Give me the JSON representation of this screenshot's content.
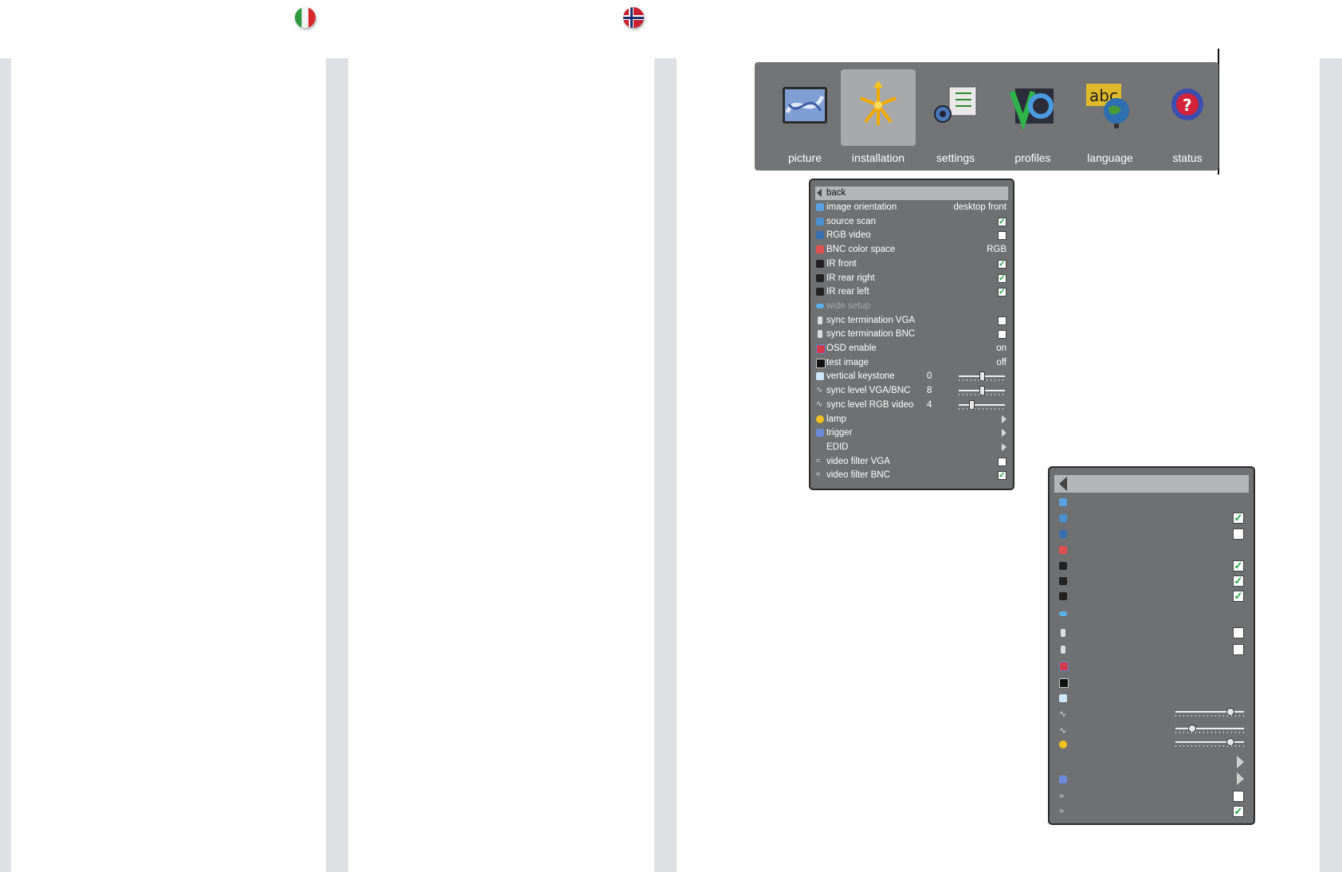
{
  "top_menu": {
    "items": [
      {
        "label": "picture",
        "icon": "picture-icon",
        "selected": false
      },
      {
        "label": "installation",
        "icon": "installation-icon",
        "selected": true
      },
      {
        "label": "settings",
        "icon": "settings-icon",
        "selected": false
      },
      {
        "label": "profiles",
        "icon": "profiles-icon",
        "selected": false
      },
      {
        "label": "language",
        "icon": "language-icon",
        "selected": false
      },
      {
        "label": "status",
        "icon": "status-icon",
        "selected": false
      }
    ]
  },
  "flags": [
    "italy-flag-icon",
    "norway-flag-icon"
  ],
  "installation_menu": {
    "back_label": "back",
    "rows": [
      {
        "label": "image orientation",
        "value": "desktop front"
      },
      {
        "label": "source scan",
        "checked": true
      },
      {
        "label": "RGB video",
        "checked": false
      },
      {
        "label": "BNC color space",
        "value": "RGB"
      },
      {
        "label": "IR front",
        "checked": true
      },
      {
        "label": "IR rear right",
        "checked": true
      },
      {
        "label": "IR rear left",
        "checked": true
      },
      {
        "label": "wide setup",
        "disabled": true
      },
      {
        "label": "sync termination VGA",
        "checked": false
      },
      {
        "label": "sync termination BNC",
        "checked": false
      },
      {
        "label": "OSD enable",
        "value": "on"
      },
      {
        "label": "test image",
        "value": "off"
      },
      {
        "label": "vertical keystone",
        "number": "0",
        "slider_level": 0.5
      },
      {
        "label": "sync level VGA/BNC",
        "number": "8",
        "slider_level": 0.5
      },
      {
        "label": "sync level RGB video",
        "number": "4",
        "slider_level": 0.25
      },
      {
        "label": "lamp",
        "submenu": true
      },
      {
        "label": "trigger",
        "submenu": true
      },
      {
        "label": "EDID",
        "submenu": true
      },
      {
        "label": "video filter VGA",
        "checked": false
      },
      {
        "label": "video filter BNC",
        "checked": true
      }
    ]
  },
  "blank_menu": {
    "check_states": {
      "r2": true,
      "r3": false,
      "r5": true,
      "r6": true,
      "r7": true,
      "r9": false,
      "r10": false,
      "r19": false,
      "r20": true
    },
    "slider_levels": [
      0.8,
      0.2,
      0.8
    ]
  },
  "colors": {
    "panel": "#6f7071",
    "highlight": "#b4b5b6",
    "check": "#1aa33a"
  }
}
